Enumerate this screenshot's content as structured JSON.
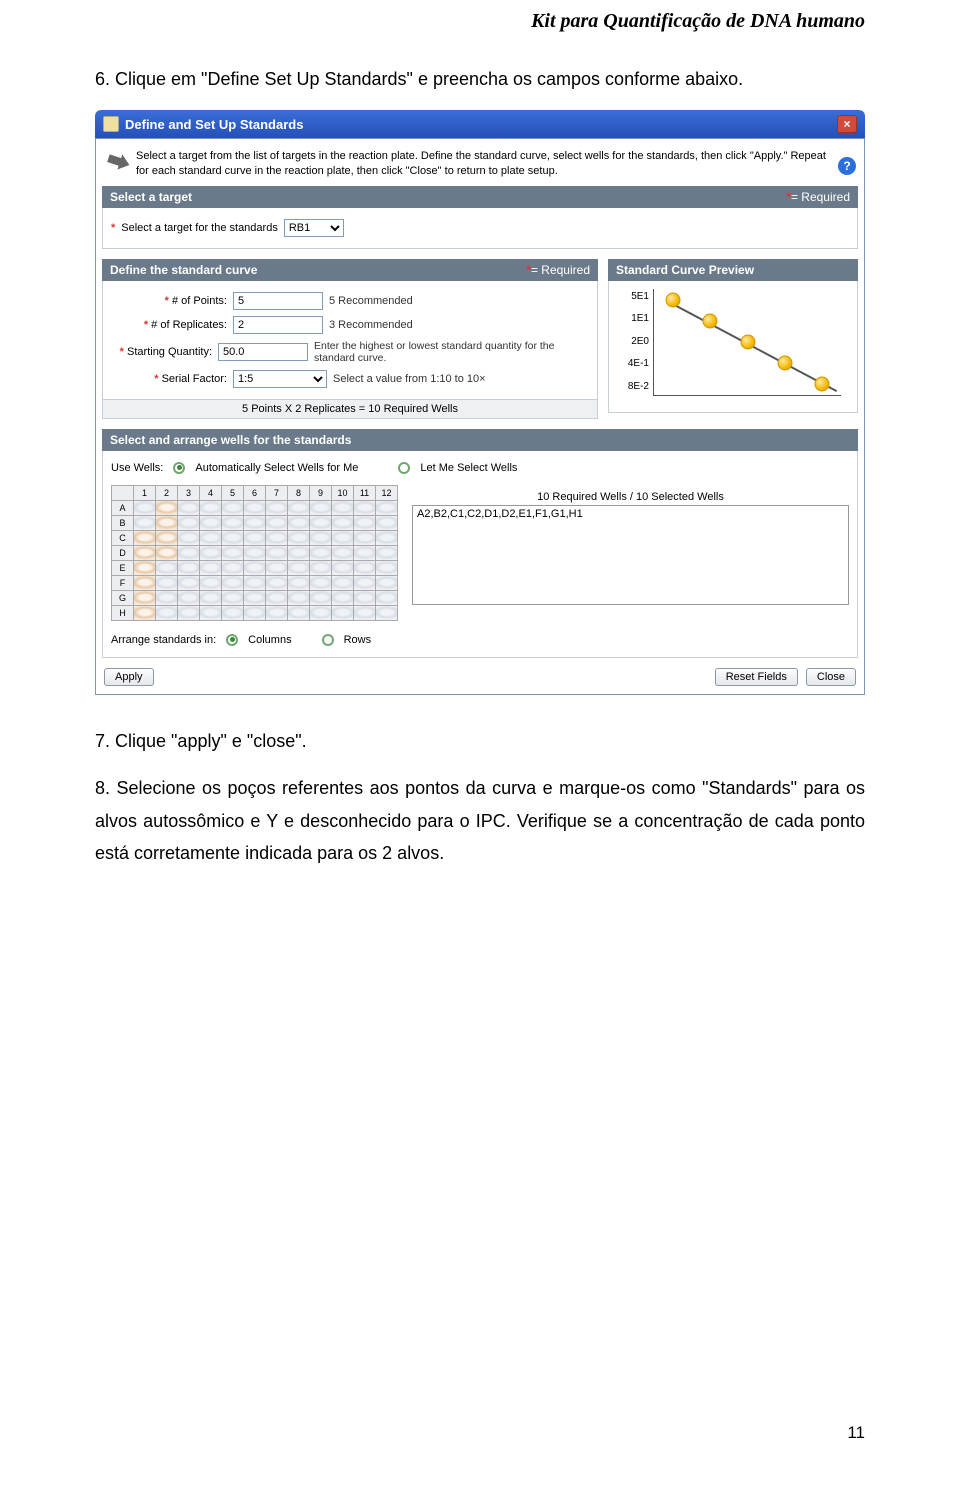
{
  "header": {
    "title": "Kit para Quantificação de DNA humano"
  },
  "step6": "6. Clique em \"Define Set Up Standards\" e preencha os campos conforme abaixo.",
  "dialog": {
    "title": "Define and Set Up Standards",
    "close_glyph": "×",
    "instructions": "Select a target from the list of targets in the reaction plate. Define the standard curve, select wells for the standards, then click \"Apply.\" Repeat for each standard curve in the reaction plate, then click \"Close\" to return to plate setup.",
    "help_glyph": "?",
    "required_label": "= Required",
    "select_target": {
      "heading": "Select a target",
      "label": "Select a target for the standards",
      "value": "RB1"
    },
    "define_curve": {
      "heading": "Define the standard curve",
      "rows": {
        "points": {
          "label": "# of Points:",
          "value": "5",
          "hint": "5 Recommended"
        },
        "replicates": {
          "label": "# of Replicates:",
          "value": "2",
          "hint": "3 Recommended"
        },
        "start_qty": {
          "label": "Starting Quantity:",
          "value": "50.0",
          "hint": "Enter the highest or lowest standard quantity for the standard curve."
        },
        "serial": {
          "label": "Serial Factor:",
          "value": "1:5",
          "hint": "Select a value from 1:10 to 10×"
        }
      },
      "summary": "5   Points X 2   Replicates = 10  Required Wells"
    },
    "preview": {
      "heading": "Standard Curve Preview",
      "ylabels": [
        "5E1",
        "1E1",
        "2E0",
        "4E-1",
        "8E-2"
      ]
    },
    "wells": {
      "heading": "Select and arrange wells for the standards",
      "use_label": "Use Wells:",
      "auto": "Automatically Select Wells for Me",
      "manual": "Let Me Select Wells",
      "cols": [
        "1",
        "2",
        "3",
        "4",
        "5",
        "6",
        "7",
        "8",
        "9",
        "10",
        "11",
        "12"
      ],
      "rows": [
        "A",
        "B",
        "C",
        "D",
        "E",
        "F",
        "G",
        "H"
      ],
      "count": "10  Required Wells / 10  Selected Wells",
      "list": "A2,B2,C1,C2,D1,D2,E1,F1,G1,H1",
      "arrange_label": "Arrange standards in:",
      "arrange_cols": "Columns",
      "arrange_rows": "Rows"
    },
    "buttons": {
      "apply": "Apply",
      "reset": "Reset Fields",
      "close": "Close"
    }
  },
  "step7": "7. Clique \"apply\" e \"close\".",
  "step8": "8. Selecione os poços referentes aos pontos da curva e marque-os como \"Standards\" para os alvos autossômico e Y e desconhecido para o IPC. Verifique se a concentração de cada ponto está corretamente indicada para os 2 alvos.",
  "page_number": "11",
  "chart_data": {
    "type": "line",
    "title": "Standard Curve Preview",
    "x": [
      1,
      2,
      3,
      4,
      5
    ],
    "y": [
      50,
      10,
      2,
      0.4,
      0.08
    ],
    "ytick_labels": [
      "5E1",
      "1E1",
      "2E0",
      "4E-1",
      "8E-2"
    ],
    "yscale": "log",
    "series": [
      {
        "name": "RB1",
        "values": [
          50,
          10,
          2,
          0.4,
          0.08
        ]
      }
    ]
  }
}
